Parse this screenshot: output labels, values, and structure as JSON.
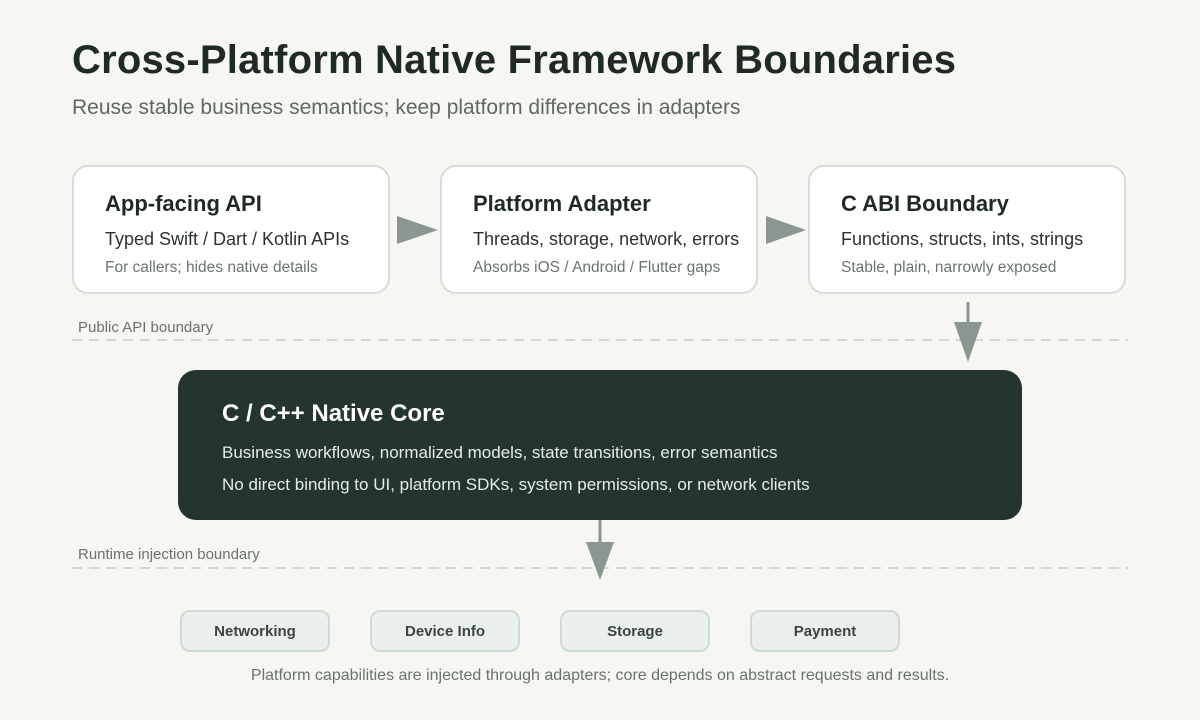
{
  "header": {
    "title": "Cross-Platform Native Framework Boundaries",
    "subtitle": "Reuse stable business semantics; keep platform differences in adapters"
  },
  "layers": [
    {
      "title": "App-facing API",
      "line1": "Typed Swift / Dart / Kotlin APIs",
      "line2": "For callers; hides native details"
    },
    {
      "title": "Platform Adapter",
      "line1": "Threads, storage, network, errors",
      "line2": "Absorbs iOS / Android / Flutter gaps"
    },
    {
      "title": "C ABI Boundary",
      "line1": "Functions, structs, ints, strings",
      "line2": "Stable, plain, narrowly exposed"
    }
  ],
  "boundaries": {
    "public_api": "Public API boundary",
    "runtime_injection": "Runtime injection boundary"
  },
  "core": {
    "title": "C / C++ Native Core",
    "line1": "Business workflows, normalized models, state transitions, error semantics",
    "line2": "No direct binding to UI, platform SDKs, system permissions, or network clients"
  },
  "capabilities": [
    "Networking",
    "Device Info",
    "Storage",
    "Payment"
  ],
  "footer_note": "Platform capabilities are injected through adapters; core depends on abstract requests and results.",
  "colors": {
    "background": "#f6f6f3",
    "core_fill": "#243530",
    "arrow": "#8a968f",
    "capability_fill": "#e8efec"
  }
}
